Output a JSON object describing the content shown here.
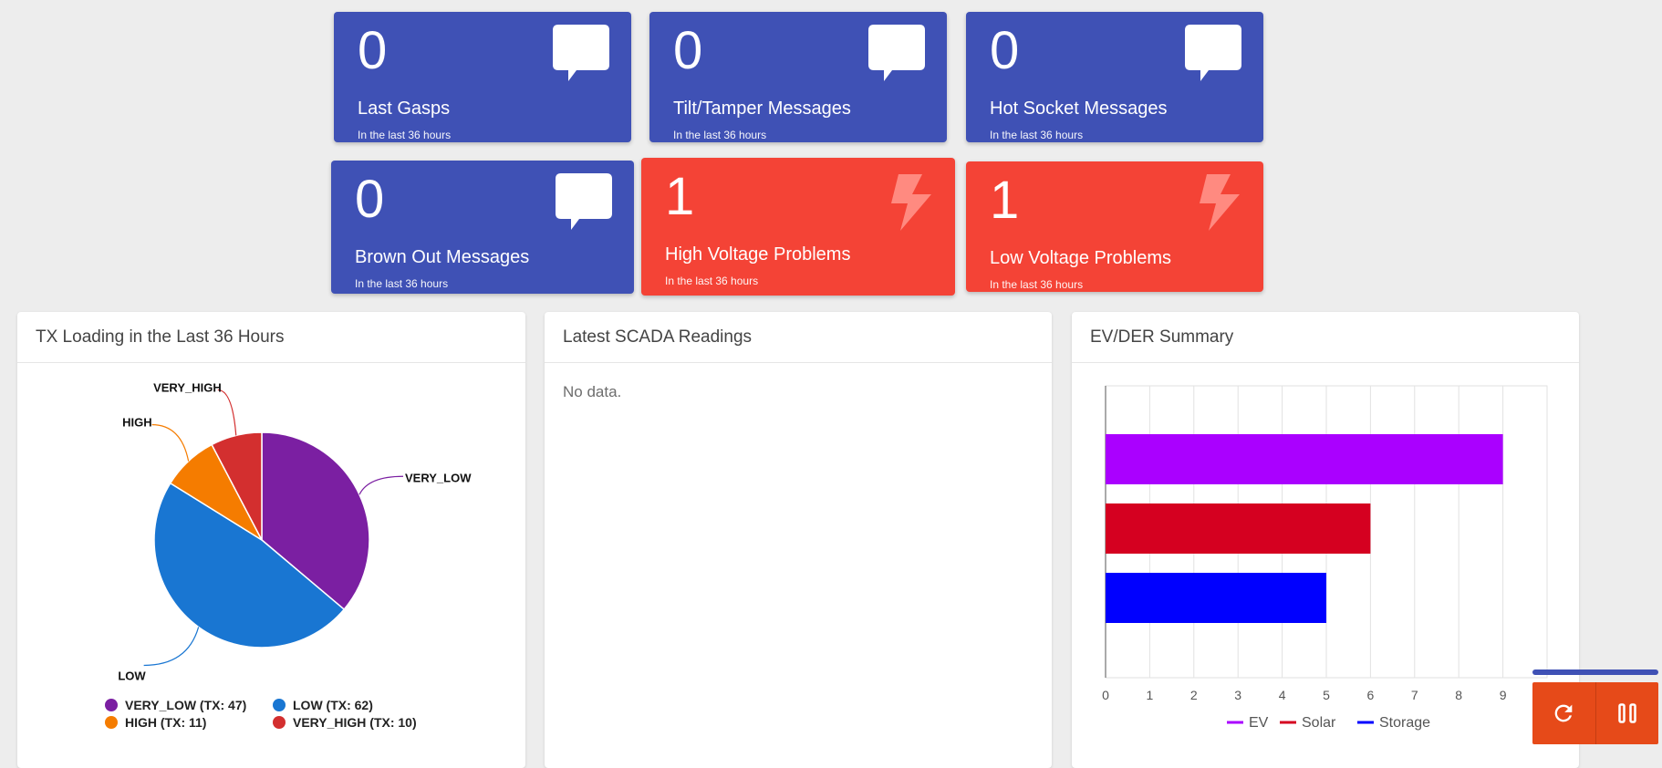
{
  "cards": [
    {
      "count": "0",
      "title": "Last Gasps",
      "sub": "In the last 36 hours",
      "icon": "message-icon"
    },
    {
      "count": "0",
      "title": "Tilt/Tamper Messages",
      "sub": "In the last 36 hours",
      "icon": "message-icon"
    },
    {
      "count": "0",
      "title": "Hot Socket Messages",
      "sub": "In the last 36 hours",
      "icon": "message-icon"
    },
    {
      "count": "0",
      "title": "Brown Out Messages",
      "sub": "In the last 36 hours",
      "icon": "message-icon"
    },
    {
      "count": "1",
      "title": "High Voltage Problems",
      "sub": "In the last 36 hours",
      "icon": "lightning-icon"
    },
    {
      "count": "1",
      "title": "Low Voltage Problems",
      "sub": "In the last 36 hours",
      "icon": "lightning-icon"
    }
  ],
  "colors": {
    "card_blue": "#3f51b5",
    "card_red": "#f44336",
    "control_orange": "#e64a19"
  },
  "panels": {
    "tx_loading": {
      "title": "TX Loading in the Last 36 Hours"
    },
    "scada": {
      "title": "Latest SCADA Readings",
      "empty_text": "No data."
    },
    "ev_der": {
      "title": "EV/DER Summary"
    }
  },
  "controls": {
    "refresh_icon": "refresh-icon",
    "pause_icon": "pause-icon"
  },
  "chart_data": [
    {
      "type": "pie",
      "title": "TX Loading in the Last 36 Hours",
      "slices": [
        {
          "label": "VERY_LOW",
          "value": 47,
          "color": "#7b1fa2",
          "legend": "VERY_LOW (TX: 47)"
        },
        {
          "label": "LOW",
          "value": 62,
          "color": "#1976d2",
          "legend": "LOW (TX: 62)"
        },
        {
          "label": "HIGH",
          "value": 11,
          "color": "#f57c00",
          "legend": "HIGH (TX: 11)"
        },
        {
          "label": "VERY_HIGH",
          "value": 10,
          "color": "#d32f2f",
          "legend": "VERY_HIGH (TX: 10)"
        }
      ]
    },
    {
      "type": "bar",
      "title": "EV/DER Summary",
      "orientation": "horizontal",
      "series": [
        {
          "name": "EV",
          "value": 9,
          "color": "#aa00ff"
        },
        {
          "name": "Solar",
          "value": 6,
          "color": "#d50020"
        },
        {
          "name": "Storage",
          "value": 5,
          "color": "#0000ff"
        }
      ],
      "xlim": [
        0,
        10
      ],
      "xticks": [
        "0",
        "1",
        "2",
        "3",
        "4",
        "5",
        "6",
        "7",
        "8",
        "9"
      ],
      "grid": true,
      "legend_position": "bottom"
    }
  ]
}
